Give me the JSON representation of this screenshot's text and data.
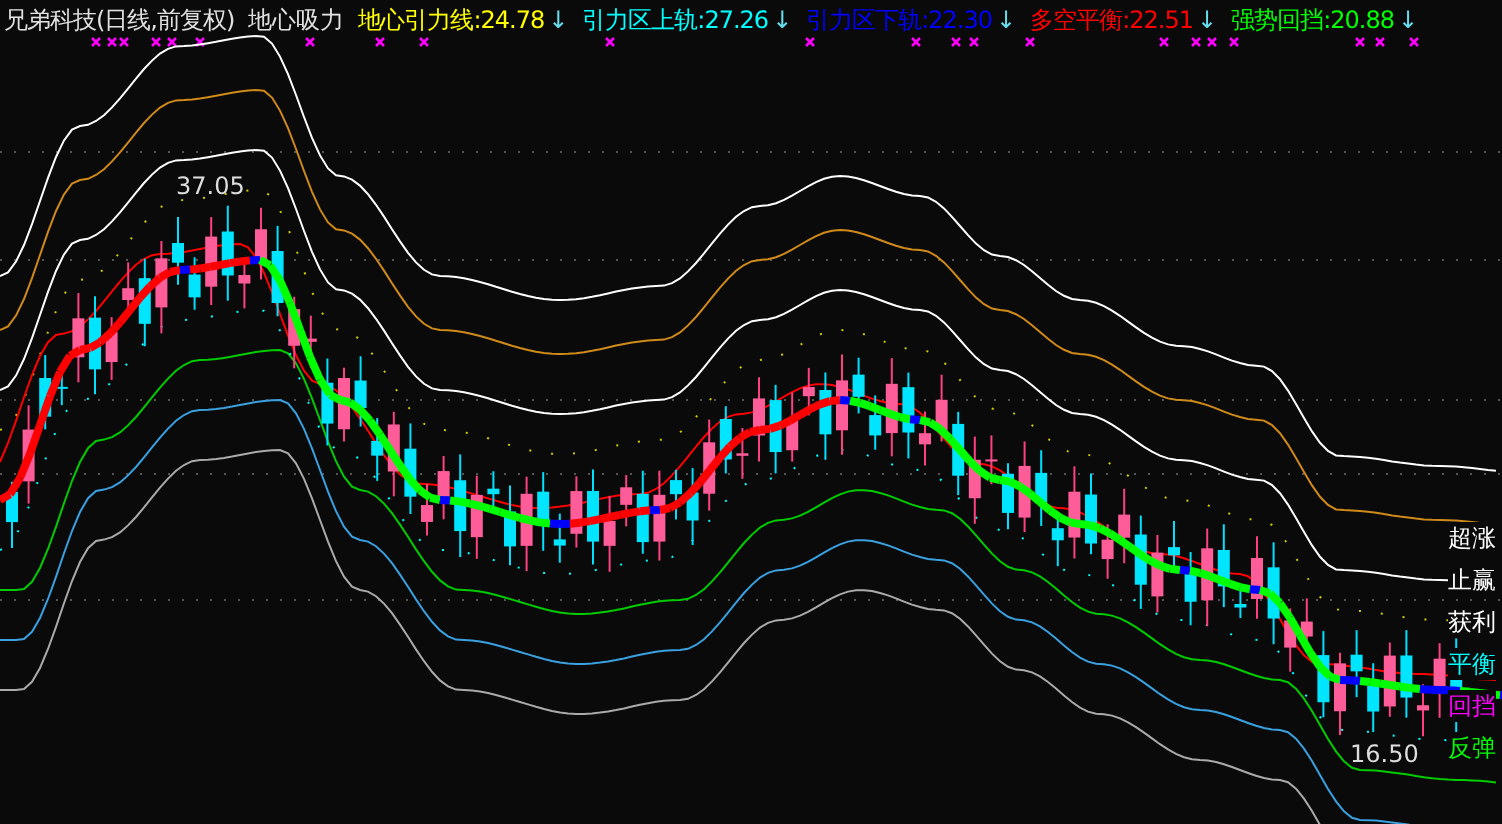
{
  "header": {
    "title": "兄弟科技(日线,前复权)",
    "indicator_name": "地心吸力",
    "indicators": [
      {
        "label": "地心引力线:",
        "value": "24.78",
        "arrow": "↓",
        "color": "#ffff00"
      },
      {
        "label": "引力区上轨:",
        "value": "27.26",
        "arrow": "↓",
        "color": "#00ffff"
      },
      {
        "label": "引力区下轨:",
        "value": "22.30",
        "arrow": "↓",
        "color": "#0000ff"
      },
      {
        "label": "多空平衡:",
        "value": "22.51",
        "arrow": "↓",
        "color": "#ff0000"
      },
      {
        "label": "强势回挡:",
        "value": "20.88",
        "arrow": "↓",
        "color": "#00ff00"
      }
    ]
  },
  "chart": {
    "price_labels": [
      {
        "text": "37.05",
        "kind": "high"
      },
      {
        "text": "16.50",
        "kind": "low"
      }
    ],
    "zone_labels": [
      {
        "text": "超涨",
        "color": "#ffffff"
      },
      {
        "text": "止赢",
        "color": "#ffffff"
      },
      {
        "text": "获利",
        "color": "#ffffff"
      },
      {
        "text": "平衡",
        "color": "#00ffff"
      },
      {
        "text": "回挡",
        "color": "#ff00ff"
      },
      {
        "text": "反弹",
        "color": "#00ff00"
      }
    ]
  }
}
